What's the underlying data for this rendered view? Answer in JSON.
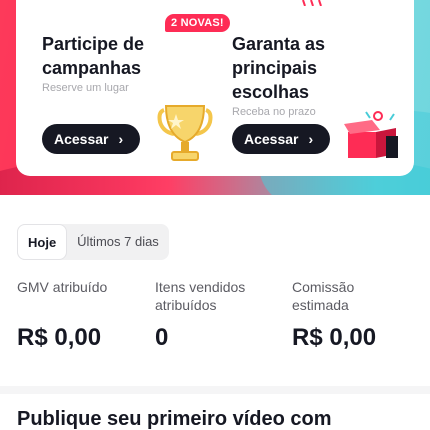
{
  "campaigns": {
    "left": {
      "badge": "2 NOVAS!",
      "title": "Participe de campanhas",
      "subtitle": "Reserve um lugar",
      "button": "Acessar",
      "icon": "trophy-icon"
    },
    "right": {
      "title": "Garanta as principais escolhas",
      "subtitle": "Receba no prazo",
      "button": "Acessar",
      "icon": "gift-box-icon"
    }
  },
  "period_tabs": [
    {
      "label": "Hoje",
      "active": true
    },
    {
      "label": "Últimos 7 dias",
      "active": false
    }
  ],
  "metrics": [
    {
      "label": "GMV atribuído",
      "value": "R$ 0,00"
    },
    {
      "label": "Itens vendidos atribuídos",
      "value": "0"
    },
    {
      "label": "Comissão estimada",
      "value": "R$ 0,00"
    }
  ],
  "promo": {
    "heading": "Publique seu primeiro vídeo com"
  },
  "colors": {
    "brand_red": "#fe2c55",
    "brand_cyan": "#48ccd8",
    "button_dark": "#161823"
  }
}
